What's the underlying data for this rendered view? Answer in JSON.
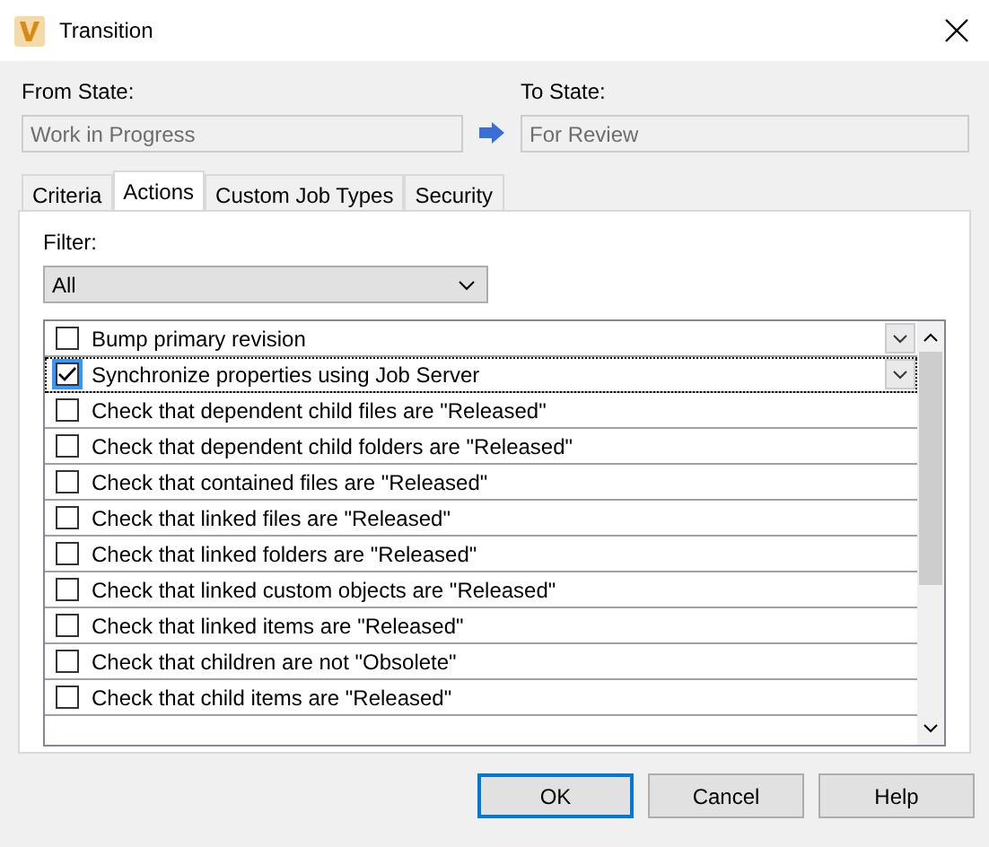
{
  "window": {
    "title": "Transition"
  },
  "from_state": {
    "label": "From State:",
    "value": "Work in Progress"
  },
  "to_state": {
    "label": "To State:",
    "value": "For Review"
  },
  "tabs": [
    {
      "label": "Criteria",
      "selected": false
    },
    {
      "label": "Actions",
      "selected": true
    },
    {
      "label": "Custom Job Types",
      "selected": false
    },
    {
      "label": "Security",
      "selected": false
    }
  ],
  "filter": {
    "label": "Filter:",
    "value": "All"
  },
  "actions": [
    {
      "label": "Bump primary revision",
      "checked": false,
      "selected": false,
      "kind": "dropdown"
    },
    {
      "label": "Synchronize properties using Job Server",
      "checked": true,
      "selected": true,
      "kind": "dropdown"
    },
    {
      "label": "Check that dependent child files are \"Released\"",
      "checked": false,
      "selected": false,
      "kind": "plain"
    },
    {
      "label": "Check that dependent child folders are \"Released\"",
      "checked": false,
      "selected": false,
      "kind": "plain"
    },
    {
      "label": "Check that contained files are \"Released\"",
      "checked": false,
      "selected": false,
      "kind": "plain"
    },
    {
      "label": "Check that linked files are \"Released\"",
      "checked": false,
      "selected": false,
      "kind": "plain"
    },
    {
      "label": "Check that linked folders are \"Released\"",
      "checked": false,
      "selected": false,
      "kind": "plain"
    },
    {
      "label": "Check that linked custom objects are \"Released\"",
      "checked": false,
      "selected": false,
      "kind": "plain"
    },
    {
      "label": "Check that linked items are \"Released\"",
      "checked": false,
      "selected": false,
      "kind": "plain"
    },
    {
      "label": "Check that children are not \"Obsolete\"",
      "checked": false,
      "selected": false,
      "kind": "plain"
    },
    {
      "label": "Check that child items are \"Released\"",
      "checked": false,
      "selected": false,
      "kind": "plain"
    }
  ],
  "buttons": [
    {
      "label": "OK",
      "default": true
    },
    {
      "label": "Cancel",
      "default": false
    },
    {
      "label": "Help",
      "default": false
    }
  ]
}
